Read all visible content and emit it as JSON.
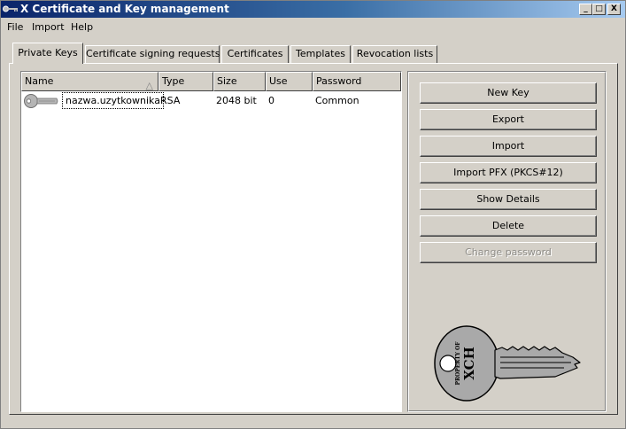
{
  "window": {
    "title": "X Certificate and Key management",
    "controls": {
      "minimize": "_",
      "maximize": "□",
      "close": "X"
    }
  },
  "menu": {
    "items": [
      "File",
      "Import",
      "Help"
    ]
  },
  "tabs": [
    {
      "label": "Private Keys",
      "active": true
    },
    {
      "label": "Certificate signing requests",
      "active": false
    },
    {
      "label": "Certificates",
      "active": false
    },
    {
      "label": "Templates",
      "active": false
    },
    {
      "label": "Revocation lists",
      "active": false
    }
  ],
  "list": {
    "columns": [
      "Name",
      "Type",
      "Size",
      "Use",
      "Password"
    ],
    "sort_indicator": "△",
    "rows": [
      {
        "name": "nazwa.uzytkownika",
        "type": "RSA",
        "size": "2048 bit",
        "use": "0",
        "password": "Common",
        "icon": "key-icon"
      }
    ]
  },
  "actions": [
    {
      "label": "New Key",
      "enabled": true
    },
    {
      "label": "Export",
      "enabled": true
    },
    {
      "label": "Import",
      "enabled": true
    },
    {
      "label": "Import PFX (PKCS#12)",
      "enabled": true
    },
    {
      "label": "Show Details",
      "enabled": true
    },
    {
      "label": "Delete",
      "enabled": true
    },
    {
      "label": "Change password",
      "enabled": false
    }
  ],
  "key_image": {
    "text_small": "PROPERTY OF",
    "text_large": "XCH",
    "icon": "key-icon"
  },
  "colors": {
    "title_bar": "#0a246a",
    "face": "#d4d0c8",
    "key_fill": "#a9a9a9"
  }
}
